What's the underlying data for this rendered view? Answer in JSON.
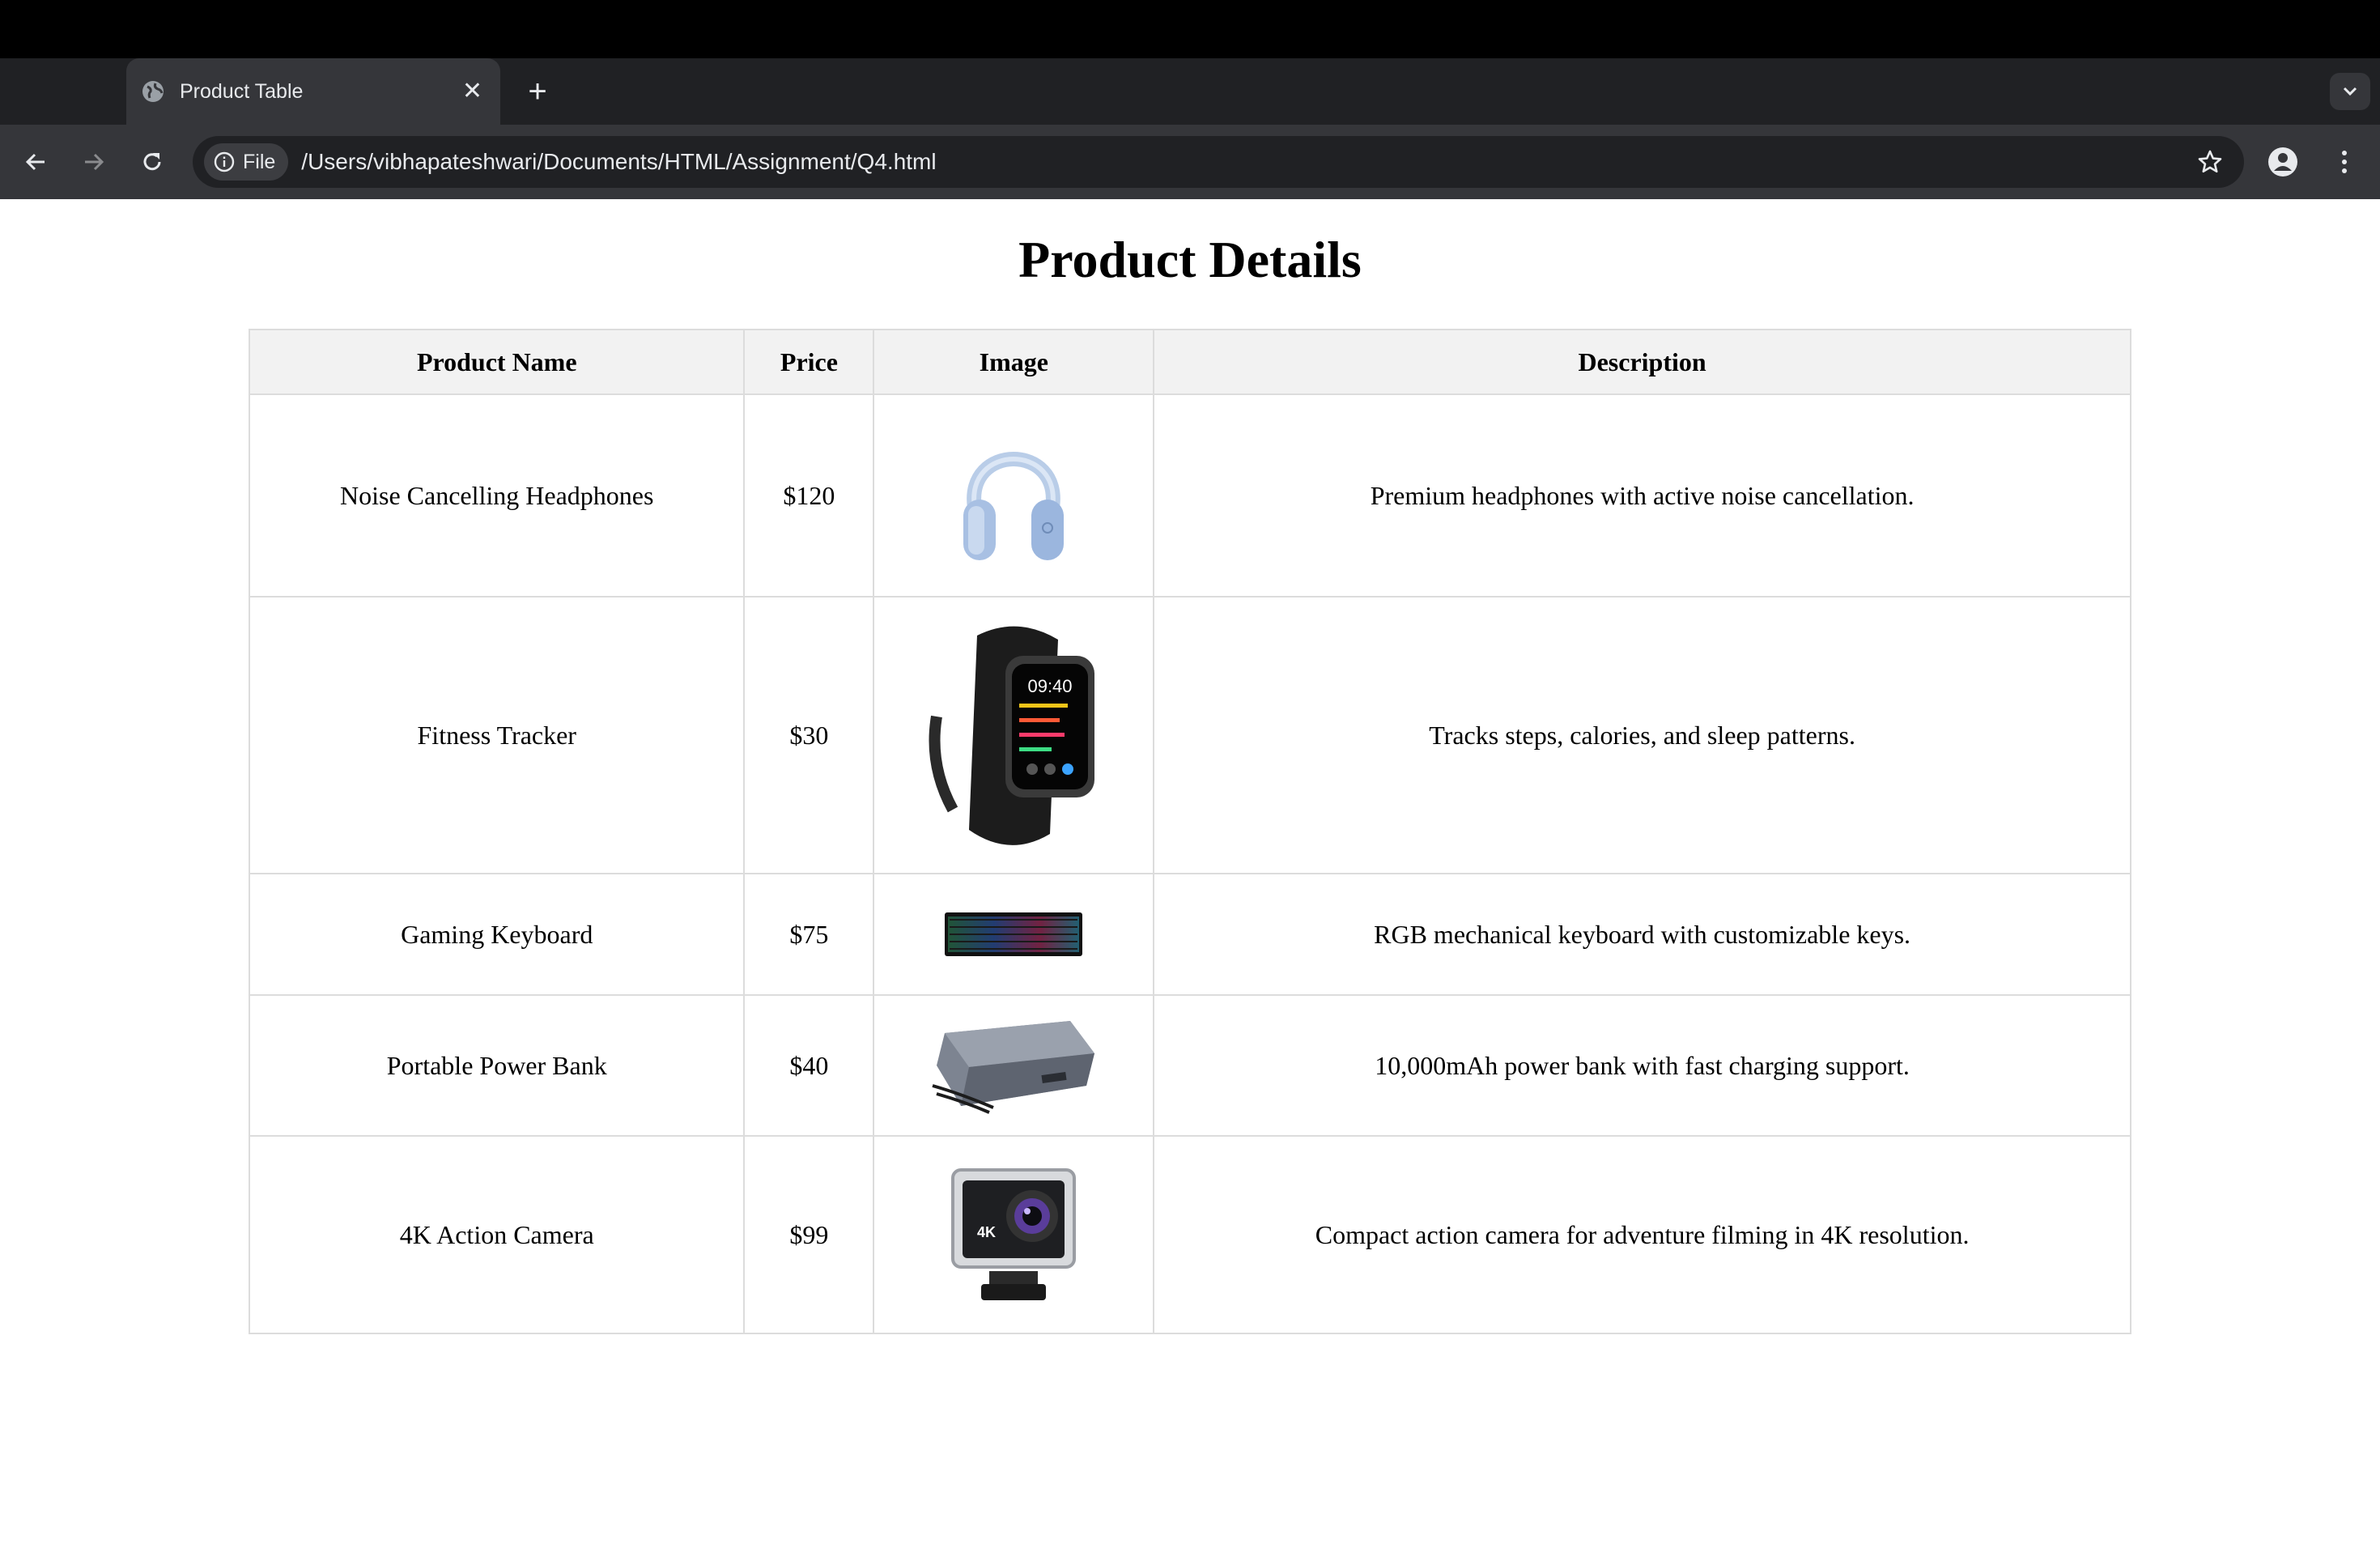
{
  "browser": {
    "tab_title": "Product Table",
    "file_chip_label": "File",
    "url": "/Users/vibhapateshwari/Documents/HTML/Assignment/Q4.html"
  },
  "page": {
    "title": "Product Details",
    "columns": [
      "Product Name",
      "Price",
      "Image",
      "Description"
    ],
    "products": [
      {
        "name": "Noise Cancelling Headphones",
        "price": "$120",
        "image_icon": "headphones-image",
        "description": "Premium headphones with active noise cancellation."
      },
      {
        "name": "Fitness Tracker",
        "price": "$30",
        "image_icon": "fitness-tracker-image",
        "description": "Tracks steps, calories, and sleep patterns."
      },
      {
        "name": "Gaming Keyboard",
        "price": "$75",
        "image_icon": "keyboard-image",
        "description": "RGB mechanical keyboard with customizable keys."
      },
      {
        "name": "Portable Power Bank",
        "price": "$40",
        "image_icon": "power-bank-image",
        "description": "10,000mAh power bank with fast charging support."
      },
      {
        "name": "4K Action Camera",
        "price": "$99",
        "image_icon": "action-camera-image",
        "description": "Compact action camera for adventure filming in 4K resolution."
      }
    ]
  }
}
